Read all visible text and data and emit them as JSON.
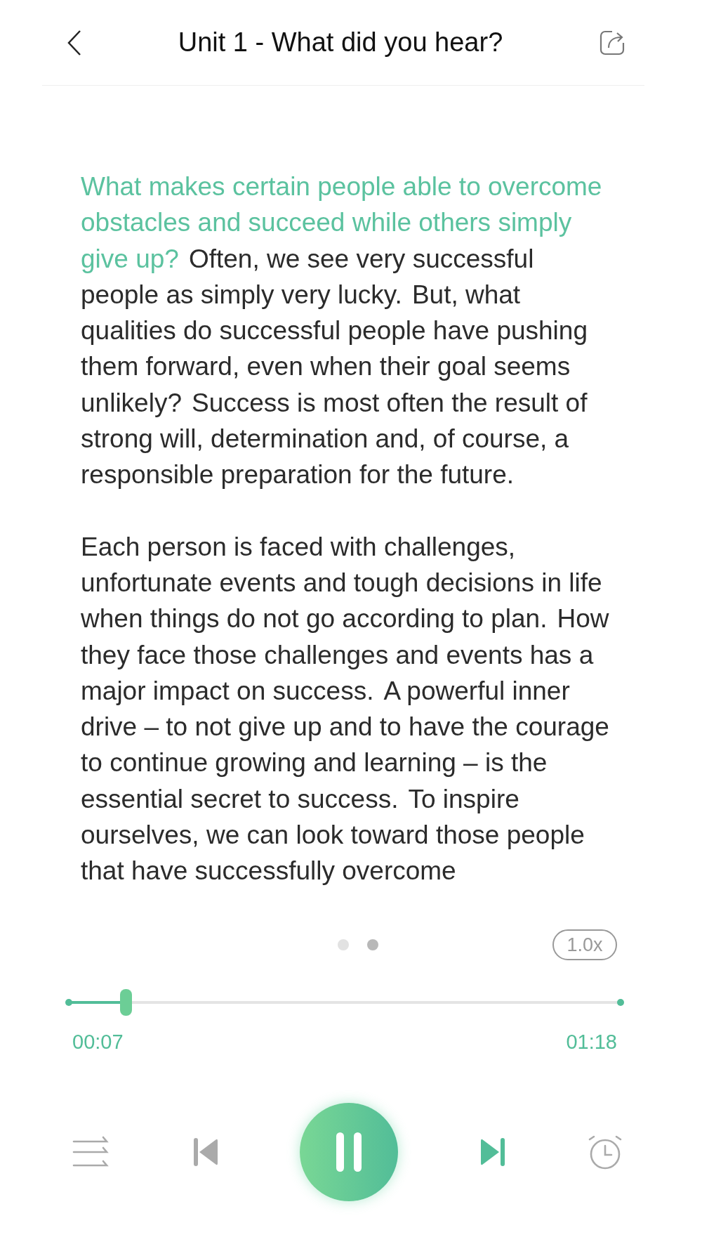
{
  "header": {
    "title": "Unit 1 - What did you hear?"
  },
  "transcript": [
    {
      "sentences": [
        {
          "text": "What makes certain people able to overcome obstacles and succeed while others simply give up?",
          "highlighted": true
        },
        {
          "text": "Often, we see very successful people as simply very lucky.",
          "highlighted": false
        },
        {
          "text": "But, what qualities do successful people have pushing them forward, even when their goal seems unlikely?",
          "highlighted": false
        },
        {
          "text": "Success is most often the result of strong will, determination and, of course, a responsible preparation for the future.",
          "highlighted": false
        }
      ]
    },
    {
      "sentences": [
        {
          "text": "Each person is faced with challenges, unfortunate events and tough decisions in life when things do not go according to plan.",
          "highlighted": false
        },
        {
          "text": "How they face those challenges and events has a major impact on success.",
          "highlighted": false
        },
        {
          "text": "A powerful inner drive – to not give up and to have the courage to continue growing and learning – is the essential secret to success.",
          "highlighted": false
        },
        {
          "text": "To inspire ourselves, we can look toward those people that have successfully overcome",
          "highlighted": false
        }
      ]
    }
  ],
  "pages": [
    {
      "selected": false
    },
    {
      "selected": true
    }
  ],
  "speed": "1.0x",
  "progress": {
    "level": 0.104,
    "elapsed": "00:07",
    "total": "01:18"
  },
  "controls": {
    "playing": true,
    "previous_disabled": true,
    "next_disabled": false
  }
}
